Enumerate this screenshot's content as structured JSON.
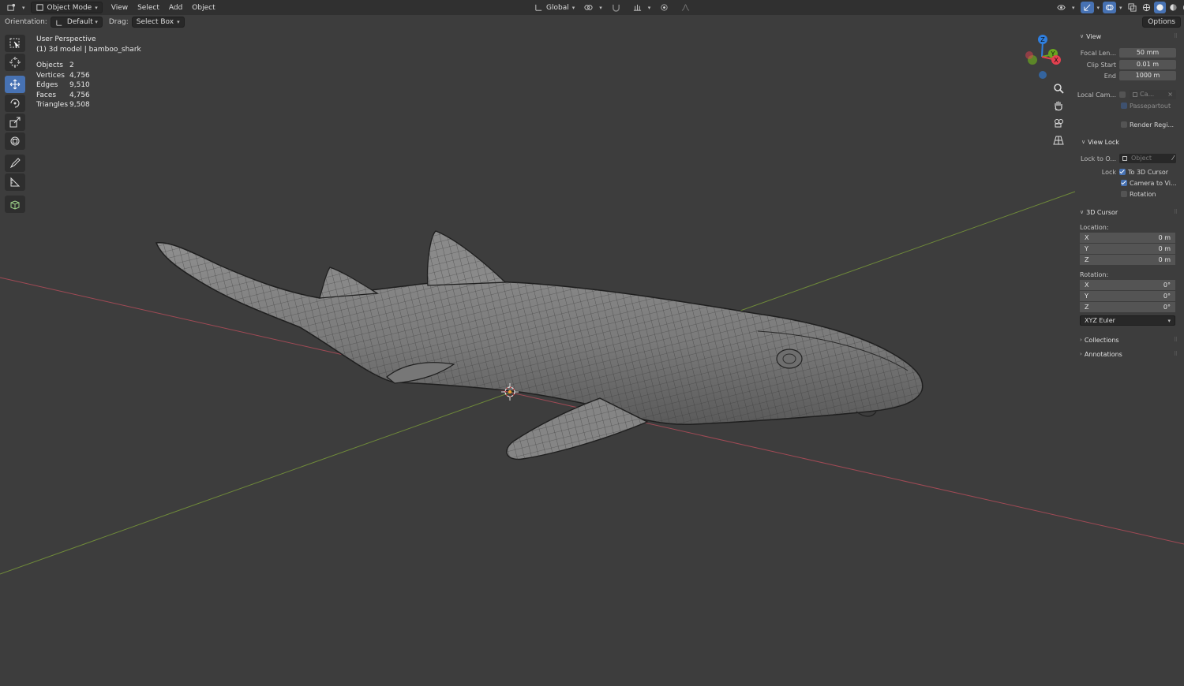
{
  "header": {
    "mode": "Object Mode",
    "menus": [
      "View",
      "Select",
      "Add",
      "Object"
    ],
    "transform_orientation": "Global"
  },
  "tool_settings": {
    "orientation_label": "Orientation:",
    "orientation_value": "Default",
    "drag_label": "Drag:",
    "drag_value": "Select Box",
    "options_label": "Options"
  },
  "overlay": {
    "perspective": "User Perspective",
    "object_name": "(1) 3d model | bamboo_shark",
    "stats": [
      {
        "label": "Objects",
        "value": "2"
      },
      {
        "label": "Vertices",
        "value": "4,756"
      },
      {
        "label": "Edges",
        "value": "9,510"
      },
      {
        "label": "Faces",
        "value": "4,756"
      },
      {
        "label": "Triangles",
        "value": "9,508"
      }
    ]
  },
  "gizmo": {
    "x": "X",
    "y": "Y",
    "z": "Z"
  },
  "sidebar": {
    "view": {
      "title": "View",
      "focal_length_label": "Focal Len...",
      "focal_length_value": "50 mm",
      "clip_start_label": "Clip Start",
      "clip_start_value": "0.01 m",
      "clip_end_label": "End",
      "clip_end_value": "1000 m",
      "local_camera_label": "Local Cam...",
      "local_camera_value": "Ca...",
      "passepartout_label": "Passepartout",
      "render_region_label": "Render Regi..."
    },
    "view_lock": {
      "title": "View Lock",
      "lock_to_object_label": "Lock to O...",
      "lock_to_object_value": "Object",
      "lock_label": "Lock",
      "to_3d_cursor_label": "To 3D Cursor",
      "camera_to_view_label": "Camera to Vi...",
      "rotation_label": "Rotation"
    },
    "cursor": {
      "title": "3D Cursor",
      "location_label": "Location:",
      "location": [
        {
          "axis": "X",
          "value": "0 m"
        },
        {
          "axis": "Y",
          "value": "0 m"
        },
        {
          "axis": "Z",
          "value": "0 m"
        }
      ],
      "rotation_label": "Rotation:",
      "rotation": [
        {
          "axis": "X",
          "value": "0°"
        },
        {
          "axis": "Y",
          "value": "0°"
        },
        {
          "axis": "Z",
          "value": "0°"
        }
      ],
      "rotation_mode": "XYZ Euler"
    },
    "collections_title": "Collections",
    "annotations_title": "Annotations"
  },
  "colors": {
    "accent": "#4772b3",
    "x_axis": "#a04a55",
    "y_axis": "#6f8a3a",
    "gizmo_x": "#e4404f",
    "gizmo_y": "#6aa51f",
    "gizmo_z": "#2f7fe0"
  }
}
